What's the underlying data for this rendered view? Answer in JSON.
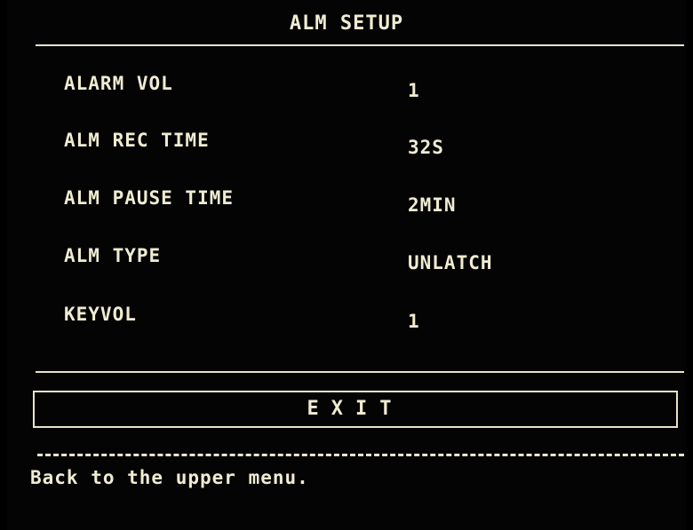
{
  "menu": {
    "title": "ALM SETUP",
    "items": [
      {
        "label": "ALARM VOL",
        "value": "1"
      },
      {
        "label": "ALM REC TIME",
        "value": "32S"
      },
      {
        "label": "ALM PAUSE TIME",
        "value": "2MIN"
      },
      {
        "label": "ALM TYPE",
        "value": "UNLATCH"
      },
      {
        "label": "KEYVOL",
        "value": "1"
      }
    ],
    "exit_label": "EXIT",
    "help_text": "Back to the upper menu."
  },
  "colors": {
    "background": "#040404",
    "foreground": "#f0ecd2"
  }
}
